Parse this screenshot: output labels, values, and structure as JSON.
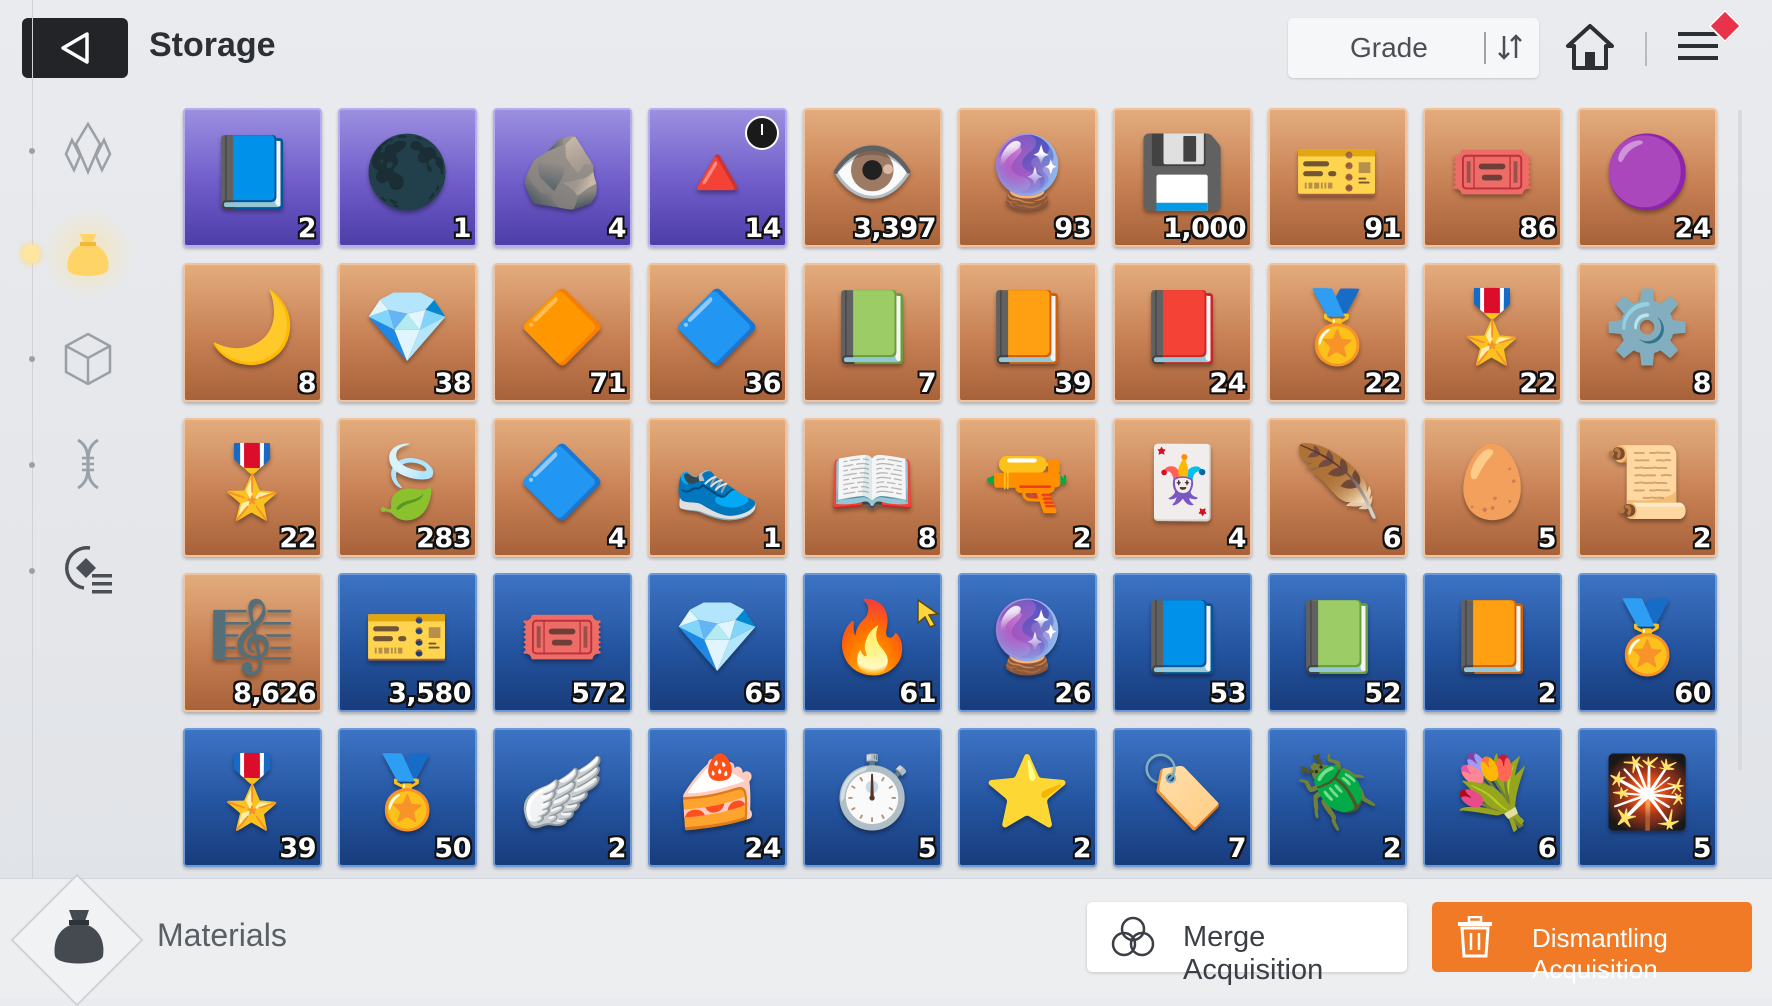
{
  "header": {
    "title": "Storage",
    "sort_label": "Grade"
  },
  "sidebar": {
    "items": [
      {
        "name": "crystal-icon",
        "active": false
      },
      {
        "name": "pouch-icon",
        "active": true
      },
      {
        "name": "cube-icon",
        "active": false
      },
      {
        "name": "dna-icon",
        "active": false
      },
      {
        "name": "record-list-icon",
        "active": false
      }
    ]
  },
  "items": [
    {
      "icon": "📘",
      "grade": "purple",
      "count": "2",
      "timer": false
    },
    {
      "icon": "🌑",
      "grade": "purple",
      "count": "1",
      "timer": false
    },
    {
      "icon": "🪨",
      "grade": "purple",
      "count": "4",
      "timer": false
    },
    {
      "icon": "🔺",
      "grade": "purple",
      "count": "14",
      "timer": true
    },
    {
      "icon": "👁️",
      "grade": "orange",
      "count": "3,397",
      "timer": false
    },
    {
      "icon": "🔮",
      "grade": "orange",
      "count": "93",
      "timer": false
    },
    {
      "icon": "💾",
      "grade": "orange",
      "count": "1,000",
      "timer": false
    },
    {
      "icon": "🎫",
      "grade": "orange",
      "count": "91",
      "timer": false
    },
    {
      "icon": "🎟️",
      "grade": "orange",
      "count": "86",
      "timer": false
    },
    {
      "icon": "🟣",
      "grade": "orange",
      "count": "24",
      "timer": false
    },
    {
      "icon": "🌙",
      "grade": "orange",
      "count": "8",
      "timer": false
    },
    {
      "icon": "💎",
      "grade": "orange",
      "count": "38",
      "timer": false
    },
    {
      "icon": "🔶",
      "grade": "orange",
      "count": "71",
      "timer": false
    },
    {
      "icon": "🔷",
      "grade": "orange",
      "count": "36",
      "timer": false
    },
    {
      "icon": "📗",
      "grade": "orange",
      "count": "7",
      "timer": false
    },
    {
      "icon": "📙",
      "grade": "orange",
      "count": "39",
      "timer": false
    },
    {
      "icon": "📕",
      "grade": "orange",
      "count": "24",
      "timer": false
    },
    {
      "icon": "🏅",
      "grade": "orange",
      "count": "22",
      "timer": false
    },
    {
      "icon": "🎖️",
      "grade": "orange",
      "count": "22",
      "timer": false
    },
    {
      "icon": "⚙️",
      "grade": "orange",
      "count": "8",
      "timer": false
    },
    {
      "icon": "🎖️",
      "grade": "orange",
      "count": "22",
      "timer": false
    },
    {
      "icon": "🍃",
      "grade": "orange",
      "count": "283",
      "timer": false
    },
    {
      "icon": "🔷",
      "grade": "orange",
      "count": "4",
      "timer": false
    },
    {
      "icon": "👟",
      "grade": "orange",
      "count": "1",
      "timer": false
    },
    {
      "icon": "📖",
      "grade": "orange",
      "count": "8",
      "timer": false
    },
    {
      "icon": "🔫",
      "grade": "orange",
      "count": "2",
      "timer": false
    },
    {
      "icon": "🃏",
      "grade": "orange",
      "count": "4",
      "timer": false
    },
    {
      "icon": "🪶",
      "grade": "orange",
      "count": "6",
      "timer": false
    },
    {
      "icon": "🥚",
      "grade": "orange",
      "count": "5",
      "timer": false
    },
    {
      "icon": "📜",
      "grade": "orange",
      "count": "2",
      "timer": false
    },
    {
      "icon": "🎼",
      "grade": "orange",
      "count": "8,626",
      "timer": false
    },
    {
      "icon": "🎫",
      "grade": "blue",
      "count": "3,580",
      "timer": false
    },
    {
      "icon": "🎟️",
      "grade": "blue",
      "count": "572",
      "timer": false
    },
    {
      "icon": "💎",
      "grade": "blue",
      "count": "65",
      "timer": false
    },
    {
      "icon": "🔥",
      "grade": "blue",
      "count": "61",
      "timer": false
    },
    {
      "icon": "🔮",
      "grade": "blue",
      "count": "26",
      "timer": false
    },
    {
      "icon": "📘",
      "grade": "blue",
      "count": "53",
      "timer": false
    },
    {
      "icon": "📗",
      "grade": "blue",
      "count": "52",
      "timer": false
    },
    {
      "icon": "📙",
      "grade": "blue",
      "count": "2",
      "timer": false
    },
    {
      "icon": "🏅",
      "grade": "blue",
      "count": "60",
      "timer": false
    },
    {
      "icon": "🎖️",
      "grade": "blue",
      "count": "39",
      "timer": false
    },
    {
      "icon": "🏅",
      "grade": "blue",
      "count": "50",
      "timer": false
    },
    {
      "icon": "🪽",
      "grade": "blue",
      "count": "2",
      "timer": false
    },
    {
      "icon": "🍰",
      "grade": "blue",
      "count": "24",
      "timer": false
    },
    {
      "icon": "⏱️",
      "grade": "blue",
      "count": "5",
      "timer": false
    },
    {
      "icon": "⭐",
      "grade": "blue",
      "count": "2",
      "timer": false
    },
    {
      "icon": "🏷️",
      "grade": "blue",
      "count": "7",
      "timer": false
    },
    {
      "icon": "🪲",
      "grade": "blue",
      "count": "2",
      "timer": false
    },
    {
      "icon": "💐",
      "grade": "blue",
      "count": "6",
      "timer": false
    },
    {
      "icon": "🎇",
      "grade": "blue",
      "count": "5",
      "timer": false
    }
  ],
  "footer": {
    "category_label": "Materials",
    "merge_label": "Merge Acquisition",
    "dismantle_label": "Dismantling Acquisition"
  },
  "colors": {
    "accent": "#f07a25",
    "grade_purple": "#6f5cc9",
    "grade_orange": "#c78054",
    "grade_blue": "#24549f"
  }
}
